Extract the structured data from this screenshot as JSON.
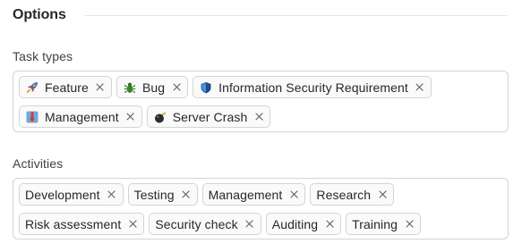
{
  "section": {
    "title": "Options"
  },
  "task_types": {
    "label": "Task types",
    "rows": [
      [
        {
          "label": "Feature",
          "icon": "rocket-icon"
        },
        {
          "label": "Bug",
          "icon": "bug-icon"
        },
        {
          "label": "Information Security Requirement",
          "icon": "shield-icon"
        }
      ],
      [
        {
          "label": "Management",
          "icon": "necktie-icon"
        },
        {
          "label": "Server Crash",
          "icon": "bomb-icon"
        }
      ]
    ]
  },
  "activities": {
    "label": "Activities",
    "rows": [
      [
        {
          "label": "Development"
        },
        {
          "label": "Testing"
        },
        {
          "label": "Management"
        },
        {
          "label": "Research"
        }
      ],
      [
        {
          "label": "Risk assessment"
        },
        {
          "label": "Security check"
        },
        {
          "label": "Auditing"
        },
        {
          "label": "Training"
        }
      ]
    ]
  }
}
